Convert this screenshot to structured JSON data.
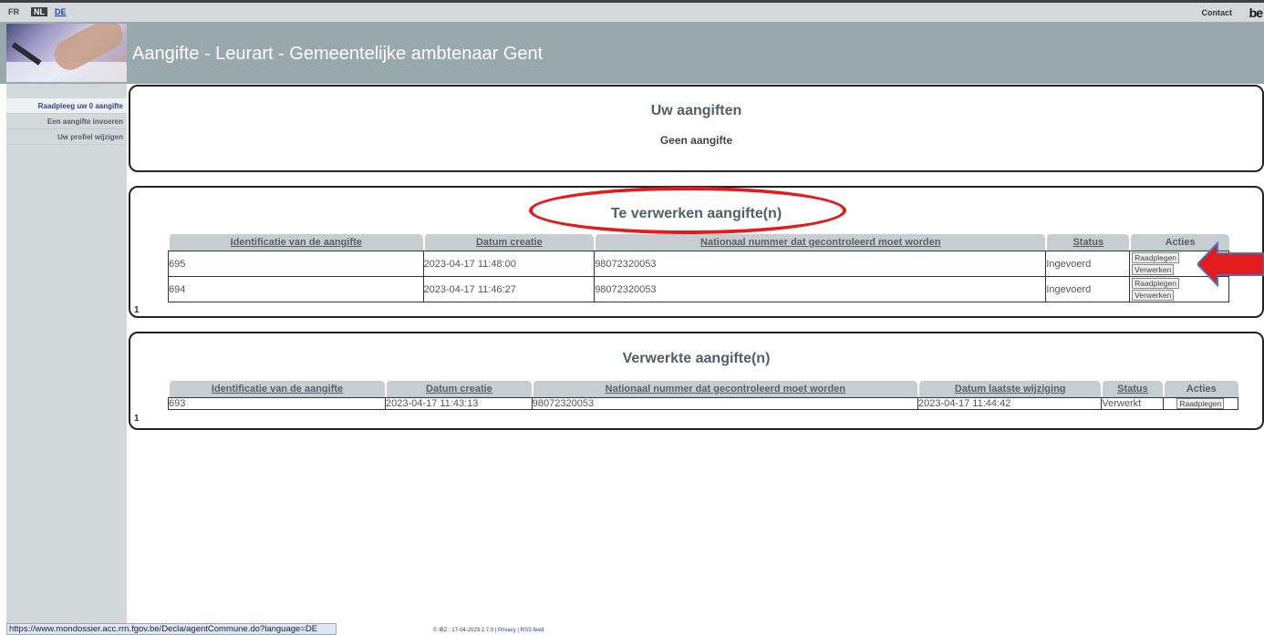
{
  "topbar": {
    "languages": [
      "FR",
      "NL",
      "DE"
    ],
    "contact": "Contact",
    "logo_text": "be"
  },
  "header": {
    "title": "Aangifte - Leurart - Gemeentelijke ambtenaar Gent"
  },
  "sidebar": {
    "items": [
      {
        "label": "Raadpleeg uw 0 aangifte",
        "active": true
      },
      {
        "label": "Een aangifte invoeren",
        "active": false
      },
      {
        "label": "Uw profiel wijzigen",
        "active": false
      }
    ]
  },
  "panel1": {
    "title": "Uw aangiften",
    "subtitle": "Geen aangifte"
  },
  "panel2": {
    "title": "Te verwerken aangifte(n)",
    "columns": [
      "Identificatie van de aangifte",
      "Datum creatie",
      "Nationaal nummer dat gecontroleerd moet worden",
      "Status",
      "Acties"
    ],
    "rows": [
      {
        "id": "695",
        "date": "2023-04-17 11:48:00",
        "nn": "98072320053",
        "status": "Ingevoerd",
        "actions": [
          "Raadplegen",
          "Verwerken"
        ]
      },
      {
        "id": "694",
        "date": "2023-04-17 11:46:27",
        "nn": "98072320053",
        "status": "Ingevoerd",
        "actions": [
          "Raadplegen",
          "Verwerken"
        ]
      }
    ],
    "page": "1"
  },
  "panel3": {
    "title": "Verwerkte aangifte(n)",
    "columns": [
      "Identificatie van de aangifte",
      "Datum creatie",
      "Nationaal nummer dat gecontroleerd moet worden",
      "Datum laatste wijziging",
      "Status",
      "Acties"
    ],
    "rows": [
      {
        "id": "693",
        "date": "2023-04-17 11:43:13",
        "nn": "98072320053",
        "modified": "2023-04-17 11:44:42",
        "status": "Verwerkt",
        "actions": [
          "Raadplegen"
        ]
      }
    ],
    "page": "1"
  },
  "statusbar": {
    "url": "https://www.mondossier.acc.rrn.fgov.be/Decla/agentCommune.do?language=DE"
  },
  "footer": {
    "text": "© IBZ : 17-04-2023 2.7.0 |",
    "privacy": "Privacy",
    "sep": "|",
    "rss": "RSS feed"
  },
  "annotation": {
    "color": "#e21b1b"
  }
}
